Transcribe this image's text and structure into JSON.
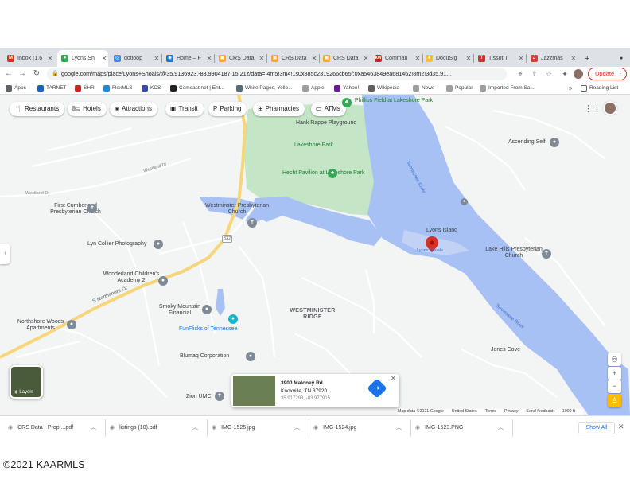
{
  "browser": {
    "tabs": [
      {
        "title": "Inbox (1,6",
        "icon": "gmail-icon",
        "color": "#d93025",
        "glyph": "M"
      },
      {
        "title": "Lyons Sh",
        "icon": "google-maps-icon",
        "color": "#34a853",
        "glyph": "●",
        "active": true
      },
      {
        "title": "dotloop",
        "icon": "dotloop-icon",
        "color": "#4285f4",
        "glyph": "◎"
      },
      {
        "title": "Home – F",
        "icon": "home-icon",
        "color": "#1a73e8",
        "glyph": "◉"
      },
      {
        "title": "CRS Data",
        "icon": "crs-icon",
        "color": "#f9a825",
        "glyph": "▣"
      },
      {
        "title": "CRS Data",
        "icon": "crs-icon",
        "color": "#f9a825",
        "glyph": "▣"
      },
      {
        "title": "CRS Data",
        "icon": "crs-icon",
        "color": "#f9a825",
        "glyph": "▣"
      },
      {
        "title": "Comman",
        "icon": "command-icon",
        "color": "#c62828",
        "glyph": "kw"
      },
      {
        "title": "DocuSig",
        "icon": "docusign-icon",
        "color": "#fbc02d",
        "glyph": "⬇"
      },
      {
        "title": "Tissot T",
        "icon": "tissot-icon",
        "color": "#d32f2f",
        "glyph": "T"
      },
      {
        "title": "Jazzmas",
        "icon": "jazz-icon",
        "color": "#e53935",
        "glyph": "J"
      }
    ],
    "new_tab": "+",
    "url": "google.com/maps/place/Lyons+Shoals/@35.9136923,-83.9904187,15.21z/data=!4m5!3m4!1s0x885c2319266cb65f:0xa5463849ea681462!8m2!3d35.91...",
    "update_label": "Update",
    "bookmarks": [
      {
        "label": "Apps",
        "icon": "apps-icon",
        "color": "#5f6368"
      },
      {
        "label": "TARNET",
        "icon": "tarnet-icon",
        "color": "#1565c0"
      },
      {
        "label": "SHR",
        "icon": "shr-icon",
        "color": "#c62828"
      },
      {
        "label": "FlexMLS",
        "icon": "flexmls-icon",
        "color": "#1e88e5"
      },
      {
        "label": "KCS",
        "icon": "kcs-icon",
        "color": "#3949ab"
      },
      {
        "label": "Comcast.net | Ent...",
        "icon": "comcast-icon",
        "color": "#212121"
      },
      {
        "label": "White Pages, Yello...",
        "icon": "whitepages-icon",
        "color": "#546e7a"
      },
      {
        "label": "Apple",
        "icon": "apple-icon",
        "color": "#9e9e9e"
      },
      {
        "label": "Yahoo!",
        "icon": "yahoo-icon",
        "color": "#6a1b9a"
      },
      {
        "label": "Wikipedia",
        "icon": "wikipedia-icon",
        "color": "#616161"
      },
      {
        "label": "News",
        "icon": "folder-icon",
        "color": "#9e9e9e"
      },
      {
        "label": "Popular",
        "icon": "folder-icon",
        "color": "#9e9e9e"
      },
      {
        "label": "Imported From Sa...",
        "icon": "folder-icon",
        "color": "#9e9e9e"
      }
    ],
    "more_bookmarks": "»",
    "reading_list": "Reading List"
  },
  "map": {
    "chips": [
      {
        "label": "Restaurants",
        "icon": "fork-knife-icon",
        "glyph": "🍴"
      },
      {
        "label": "Hotels",
        "icon": "bed-icon",
        "glyph": "🛏"
      },
      {
        "label": "Attractions",
        "icon": "camera-icon",
        "glyph": "◈"
      },
      {
        "label": "Transit",
        "icon": "bus-icon",
        "glyph": "▣"
      },
      {
        "label": "Parking",
        "icon": "parking-icon",
        "glyph": "P"
      },
      {
        "label": "Pharmacies",
        "icon": "pharmacy-icon",
        "glyph": "⊞"
      },
      {
        "label": "ATMs",
        "icon": "atm-icon",
        "glyph": "▭"
      }
    ],
    "places": {
      "phillips_field": "Phillips Field at Lakeshore Park",
      "hank_rappe": "Hank Rappe Playground",
      "lakeshore_park": "Lakeshore Park",
      "hecht_pavilion": "Hecht Pavilion at Lakeshore Park",
      "ascending_self": "Ascending Self",
      "westland_dr": "Westland Dr",
      "westland_dr2": "Westland Dr",
      "first_cumberland": "First Cumberland Presbyterian Church",
      "westminster_pres": "Westminster Presbyterian Church",
      "lyn_collier": "Lyn Collier Photography",
      "wonderland": "Wonderland Children's Academy 2",
      "lyons_island": "Lyons Island",
      "lyons_shoals": "Lyons Shoals",
      "lake_hills": "Lake Hills Presbyterian Church",
      "northshore_woods": "Northshore Woods Apartments",
      "s_northshore": "S Northshore Dr",
      "smoky_mountain": "Smoky Mountain Financial",
      "westminister_ridge": "WESTMINISTER RIDGE",
      "funflicks": "FunFlicks of Tennessee",
      "blumaq": "Blumaq Corporation",
      "zion_umc": "Zion UMC",
      "jones_cove": "Jones Cove",
      "tennessee_river_1": "Tennessee River",
      "tennessee_river_2": "Tennessee River",
      "route_332": "332"
    },
    "info_card": {
      "address": "3900 Maloney Rd",
      "city": "Knoxville, TN 37920",
      "coords": "35.917298, -83.977915"
    },
    "layers_label": "Layers",
    "attribution": [
      "Map data ©2021 Google",
      "United States",
      "Terms",
      "Privacy",
      "Send feedback",
      "1000 ft"
    ]
  },
  "downloads": {
    "items": [
      {
        "name": "CRS Data - Prop....pdf",
        "icon": "pdf-icon"
      },
      {
        "name": "listings (10).pdf",
        "icon": "pdf-icon"
      },
      {
        "name": "IMG-1525.jpg",
        "icon": "image-icon"
      },
      {
        "name": "IMG-1524.jpg",
        "icon": "image-icon"
      },
      {
        "name": "IMG-1523.PNG",
        "icon": "image-icon"
      }
    ],
    "show_all": "Show All"
  },
  "footer": {
    "copyright": "©2021 KAARMLS"
  },
  "colors": {
    "water": "#a8c1f5",
    "park": "#c5e6c6",
    "land": "#f3f4f4",
    "road": "#ffffff",
    "highway": "#f7d57a",
    "pin": "#d93025"
  }
}
